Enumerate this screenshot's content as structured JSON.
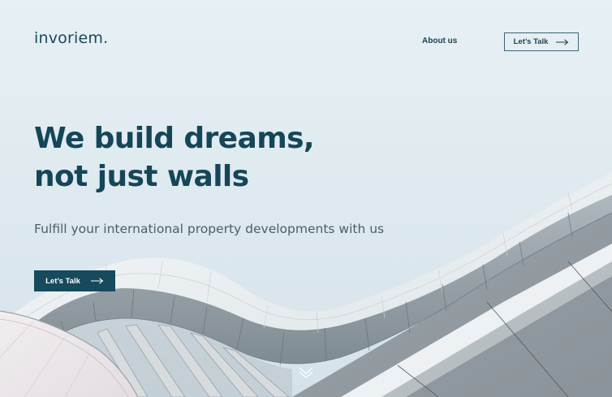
{
  "brand": {
    "logo_text": "invoriem."
  },
  "nav": {
    "about_label": "About us",
    "cta_label": "Let’s Talk",
    "cta_icon": "arrow-right-icon"
  },
  "hero": {
    "headline_line1": "We build dreams,",
    "headline_line2": "not just walls",
    "subheadline": "Fulfill your international property developments with us",
    "cta_label": "Let’s Talk",
    "cta_icon": "arrow-right-icon",
    "scroll_icon": "chevron-down-icon",
    "image_subject": "curved white architectural facade"
  },
  "colors": {
    "primary": "#164a5d",
    "background": "#e3edf2",
    "text_muted": "#4e5d65"
  }
}
